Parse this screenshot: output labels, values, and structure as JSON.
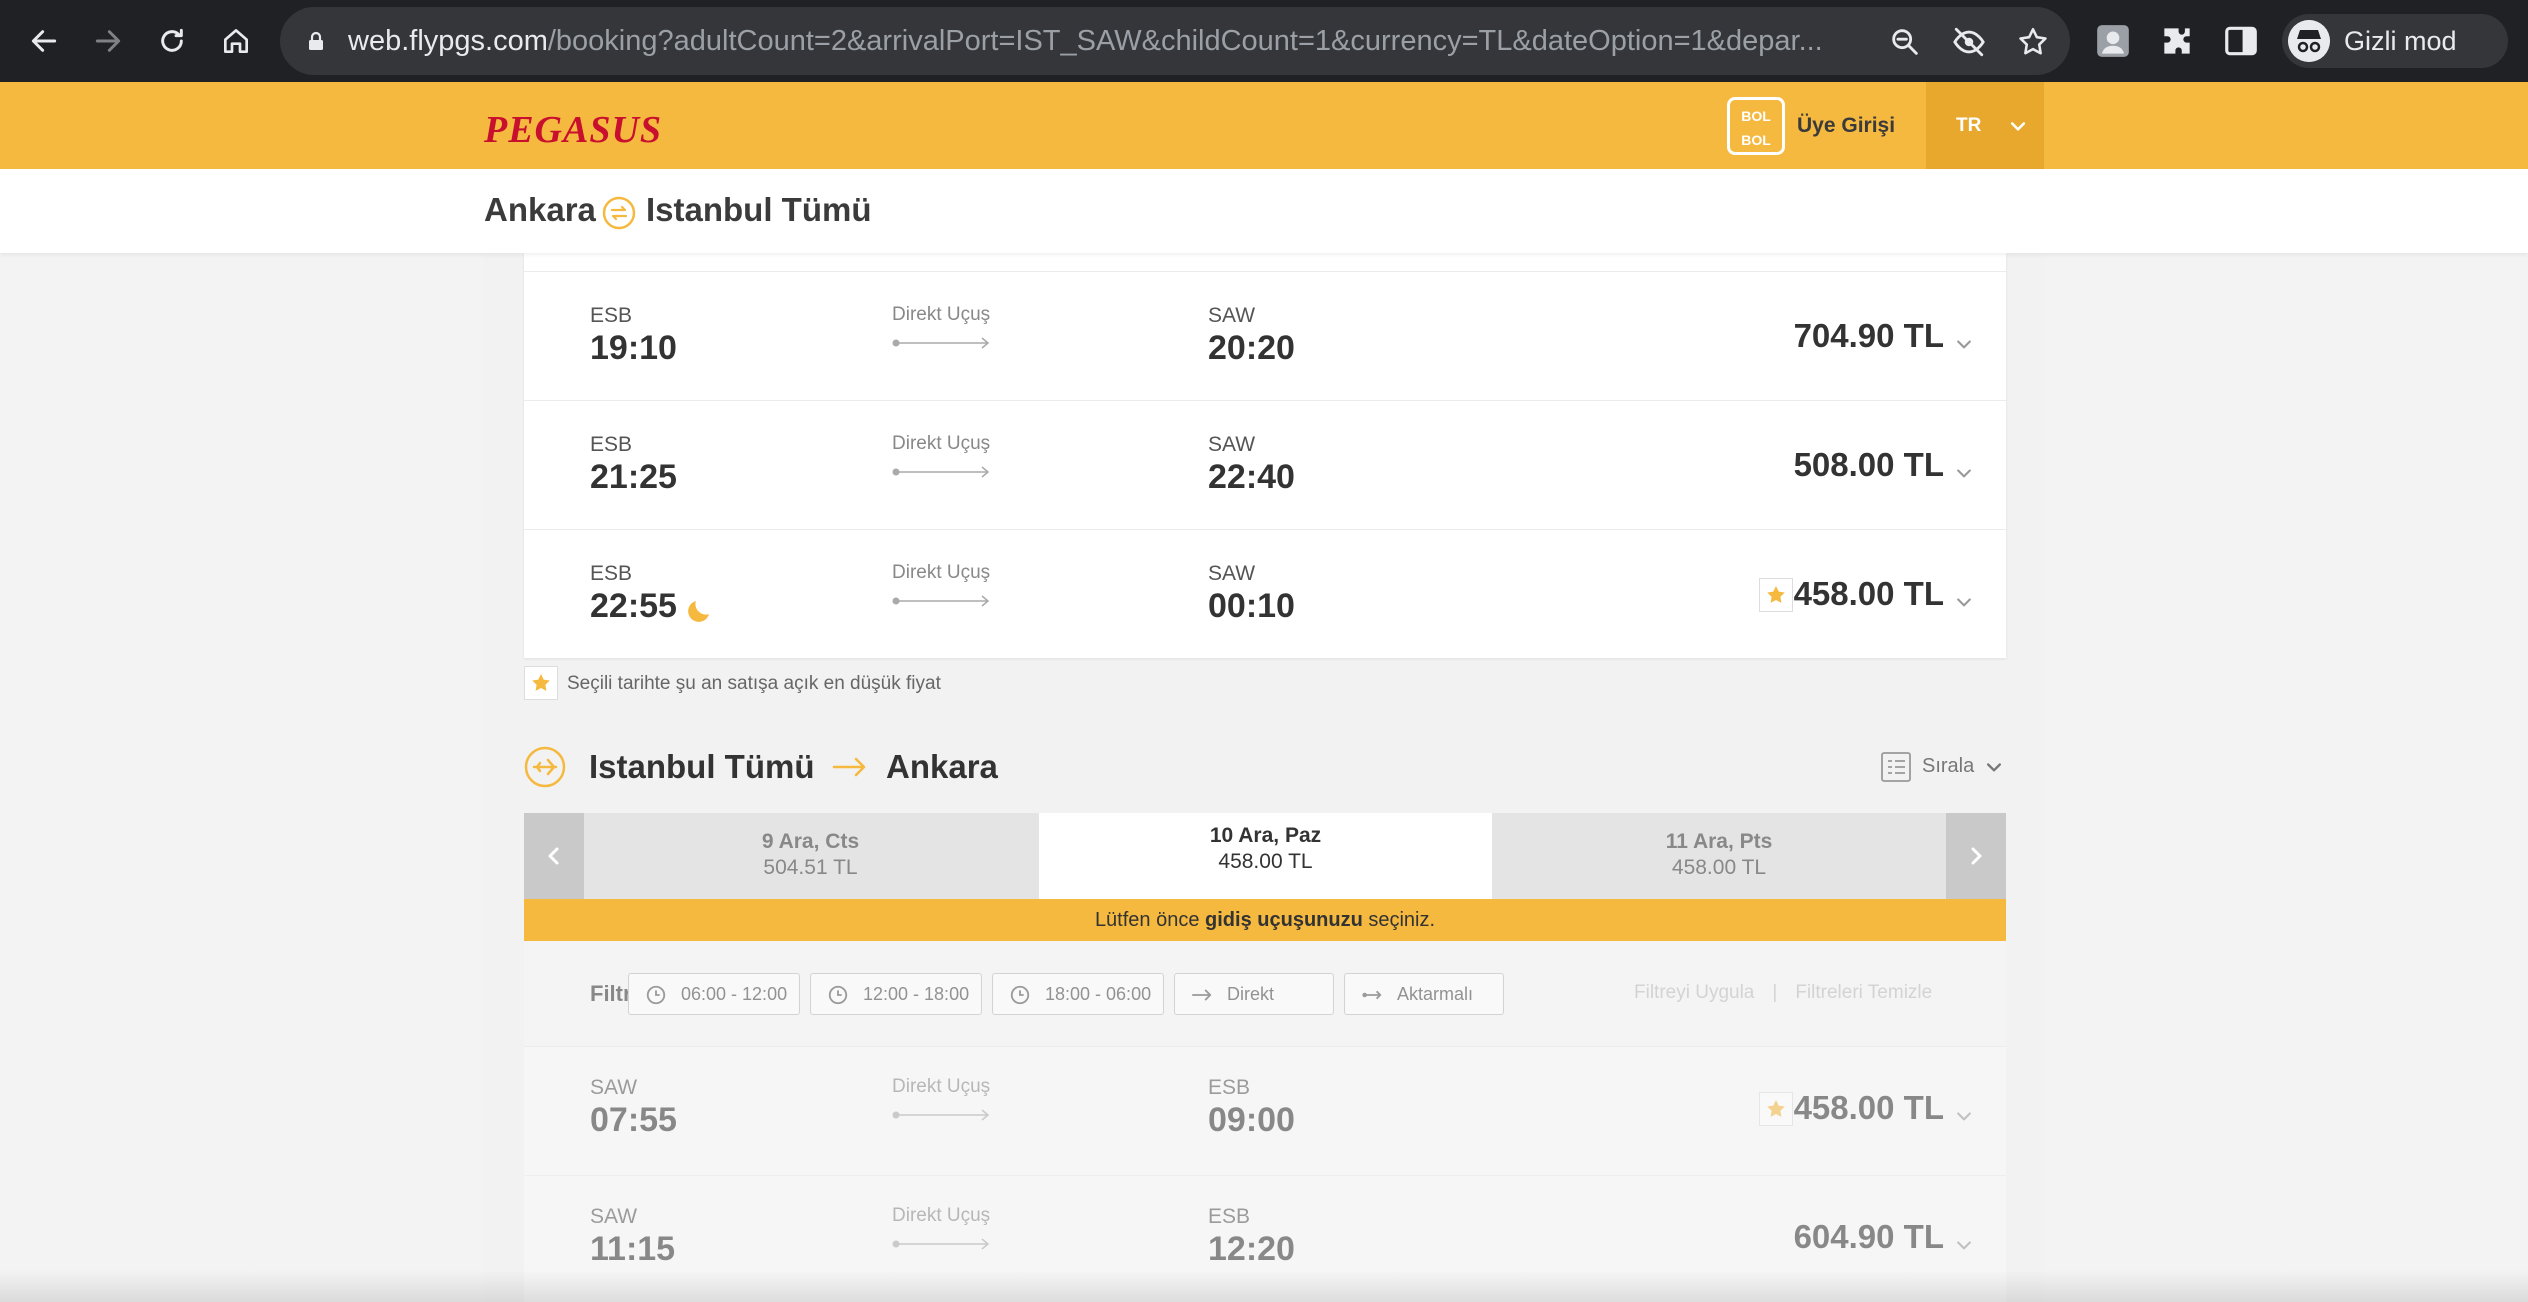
{
  "browser": {
    "url_host": "web.flypgs.com",
    "url_rest": "/booking?adultCount=2&arrivalPort=IST_SAW&childCount=1&currency=TL&dateOption=1&depar...",
    "profile_label": "Gizli mod"
  },
  "header": {
    "logo": "PEGASUS",
    "bolbol_top": "BOL",
    "bolbol_bottom": "BOL",
    "login_label": "Üye Girişi",
    "language": "TR"
  },
  "route": {
    "from": "Ankara",
    "to": "Istanbul Tümü"
  },
  "outbound_flights": [
    {
      "dep_code": "ESB",
      "dep_time": "19:10",
      "type": "Direkt Uçuş",
      "arr_code": "SAW",
      "arr_time": "20:20",
      "price": "704.90 TL",
      "lowest": false,
      "night": false
    },
    {
      "dep_code": "ESB",
      "dep_time": "21:25",
      "type": "Direkt Uçuş",
      "arr_code": "SAW",
      "arr_time": "22:40",
      "price": "508.00 TL",
      "lowest": false,
      "night": false
    },
    {
      "dep_code": "ESB",
      "dep_time": "22:55",
      "type": "Direkt Uçuş",
      "arr_code": "SAW",
      "arr_time": "00:10",
      "price": "458.00 TL",
      "lowest": true,
      "night": true
    }
  ],
  "legend_text": "Seçili tarihte şu an satışa açık en düşük fiyat",
  "return_section": {
    "from": "Istanbul Tümü",
    "to": "Ankara",
    "sort_label": "Sırala",
    "dates": [
      {
        "label": "9 Ara, Cts",
        "price": "504.51 TL"
      },
      {
        "label": "10 Ara, Paz",
        "price": "458.00 TL"
      },
      {
        "label": "11 Ara, Pts",
        "price": "458.00 TL"
      }
    ],
    "notice_prefix": "Lütfen önce ",
    "notice_bold": "gidiş uçuşunuzu",
    "notice_suffix": " seçiniz.",
    "filter_label": "Filtrele",
    "filters": [
      "06:00 - 12:00",
      "12:00 - 18:00",
      "18:00 - 06:00",
      "Direkt",
      "Aktarmalı"
    ],
    "apply_filter": "Filtreyi Uygula",
    "clear_filters": "Filtreleri Temizle",
    "flights": [
      {
        "dep_code": "SAW",
        "dep_time": "07:55",
        "type": "Direkt Uçuş",
        "arr_code": "ESB",
        "arr_time": "09:00",
        "price": "458.00 TL",
        "lowest": true
      },
      {
        "dep_code": "SAW",
        "dep_time": "11:15",
        "type": "Direkt Uçuş",
        "arr_code": "ESB",
        "arr_time": "12:20",
        "price": "604.90 TL",
        "lowest": false
      }
    ]
  },
  "colors": {
    "brand_yellow": "#f5b940",
    "brand_red": "#c8102e"
  }
}
